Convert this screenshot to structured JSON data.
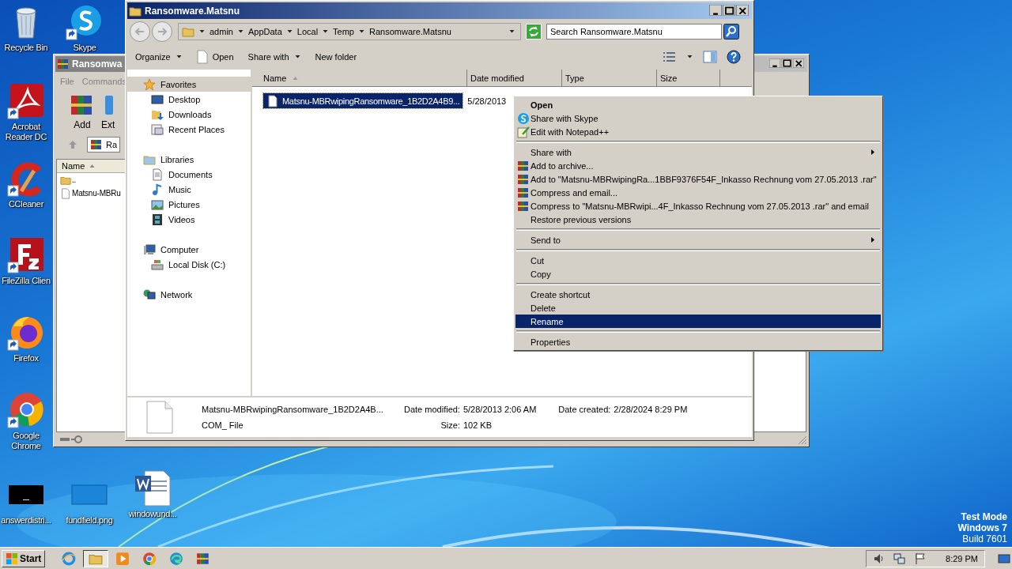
{
  "desktop_icons": [
    {
      "label": "Recycle Bin",
      "kind": "trash",
      "shortcut": false
    },
    {
      "label": "Skype",
      "kind": "circle",
      "shortcut": true
    },
    {
      "label": "Acrobat Reader DC",
      "kind": "acrobat",
      "shortcut": true
    },
    {
      "label": "CCleaner",
      "kind": "arc",
      "shortcut": true
    },
    {
      "label": "FileZilla Clien",
      "kind": "fz",
      "shortcut": true
    },
    {
      "label": "Firefox",
      "kind": "fox",
      "shortcut": true
    },
    {
      "label": "Google Chrome",
      "kind": "ring",
      "shortcut": true
    },
    {
      "label": "answerdistri...",
      "kind": "dark",
      "shortcut": false
    },
    {
      "label": "fundfield.png",
      "kind": "blank",
      "shortcut": false
    },
    {
      "label": "windowund...",
      "kind": "word",
      "shortcut": false
    }
  ],
  "winrar": {
    "title": "Ransomwa",
    "menu": [
      "File",
      "Commands"
    ],
    "tools": [
      {
        "label": "Add",
        "kind": "books"
      },
      {
        "label": "Ext",
        "kind": "extract"
      }
    ],
    "address": "Ra",
    "column": "Name",
    "rows": [
      {
        "name": "..",
        "kind": "folder"
      },
      {
        "name": "Matsnu-MBRu",
        "kind": "file"
      }
    ]
  },
  "explorer": {
    "title": "Ransomware.Matsnu",
    "breadcrumb": [
      "admin",
      "AppData",
      "Local",
      "Temp",
      "Ransomware.Matsnu"
    ],
    "search": {
      "placeholder": "Search Ransomware.Matsnu"
    },
    "toolbar": [
      {
        "label": "Organize",
        "kind": "menu"
      },
      {
        "label": "Open",
        "kind": "open"
      },
      {
        "label": "Share with",
        "kind": "menu"
      },
      {
        "label": "New folder",
        "kind": "plain"
      }
    ],
    "nav": [
      {
        "label": "Favorites",
        "kind": "star",
        "selected": true,
        "children": [
          {
            "label": "Desktop",
            "kind": "desktop",
            "selected": false
          },
          {
            "label": "Downloads",
            "kind": "downloads",
            "selected": false
          },
          {
            "label": "Recent Places",
            "kind": "recent",
            "selected": false
          }
        ]
      },
      {
        "label": "Libraries",
        "kind": "libraries",
        "selected": false,
        "children": [
          {
            "label": "Documents",
            "kind": "documents",
            "selected": false
          },
          {
            "label": "Music",
            "kind": "music",
            "selected": false
          },
          {
            "label": "Pictures",
            "kind": "pictures",
            "selected": false
          },
          {
            "label": "Videos",
            "kind": "videos",
            "selected": false
          }
        ]
      },
      {
        "label": "Computer",
        "kind": "computer",
        "selected": false,
        "children": [
          {
            "label": "Local Disk (C:)",
            "kind": "disk",
            "selected": false
          }
        ]
      },
      {
        "label": "Network",
        "kind": "network",
        "selected": false
      }
    ],
    "columns": [
      {
        "label": "Name",
        "sorted": true
      },
      {
        "label": "Date modified",
        "sorted": false
      },
      {
        "label": "Type",
        "sorted": false
      },
      {
        "label": "Size",
        "sorted": false
      }
    ],
    "files": [
      {
        "name": "Matsnu-MBRwipingRansomware_1B2D2A4B9...",
        "date": "5/28/2013",
        "selected": true
      }
    ],
    "details": {
      "name": "Matsnu-MBRwipingRansomware_1B2D2A4B...",
      "type": "COM_ File",
      "fields": [
        {
          "label": "Date modified:",
          "value": "5/28/2013 2:06 AM"
        },
        {
          "label": "Size:",
          "value": "102 KB"
        },
        {
          "label": "Date created:",
          "value": "2/28/2024 8:29 PM"
        }
      ]
    }
  },
  "context_menu": [
    {
      "kind": "item",
      "label": "Open",
      "bold": true,
      "selected": false
    },
    {
      "kind": "skype",
      "label": "Share with Skype",
      "selected": false
    },
    {
      "kind": "notepad",
      "label": "Edit with Notepad++",
      "selected": false
    },
    {
      "kind": "separator"
    },
    {
      "kind": "item",
      "label": "Share with",
      "submenu": true,
      "selected": false
    },
    {
      "kind": "winrar",
      "label": "Add to archive...",
      "selected": false
    },
    {
      "kind": "winrar",
      "label": "Add to \"Matsnu-MBRwipingRa...1BBF9376F54F_Inkasso Rechnung vom 27.05.2013 .rar\"",
      "selected": false
    },
    {
      "kind": "winrar",
      "label": "Compress and email...",
      "selected": false
    },
    {
      "kind": "winrar",
      "label": "Compress to \"Matsnu-MBRwipi...4F_Inkasso Rechnung vom 27.05.2013 .rar\" and email",
      "selected": false
    },
    {
      "kind": "item",
      "label": "Restore previous versions",
      "selected": false
    },
    {
      "kind": "separator"
    },
    {
      "kind": "item",
      "label": "Send to",
      "submenu": true,
      "selected": false
    },
    {
      "kind": "separator"
    },
    {
      "kind": "item",
      "label": "Cut",
      "selected": false
    },
    {
      "kind": "item",
      "label": "Copy",
      "selected": false
    },
    {
      "kind": "separator"
    },
    {
      "kind": "item",
      "label": "Create shortcut",
      "selected": false
    },
    {
      "kind": "item",
      "label": "Delete",
      "selected": false
    },
    {
      "kind": "item",
      "label": "Rename",
      "selected": true
    },
    {
      "kind": "separator"
    },
    {
      "kind": "item",
      "label": "Properties",
      "selected": false
    }
  ],
  "system_notice": [
    "Test Mode",
    "Windows 7",
    "Build 7601"
  ],
  "taskbar": {
    "start": "Start",
    "apps": [
      {
        "kind": "ie",
        "active": false
      },
      {
        "kind": "folder",
        "active": true
      },
      {
        "kind": "media",
        "active": false
      },
      {
        "kind": "chrome",
        "active": false
      },
      {
        "kind": "edge",
        "active": false
      },
      {
        "kind": "winrar",
        "active": false
      }
    ],
    "clock": "8:29 PM"
  }
}
